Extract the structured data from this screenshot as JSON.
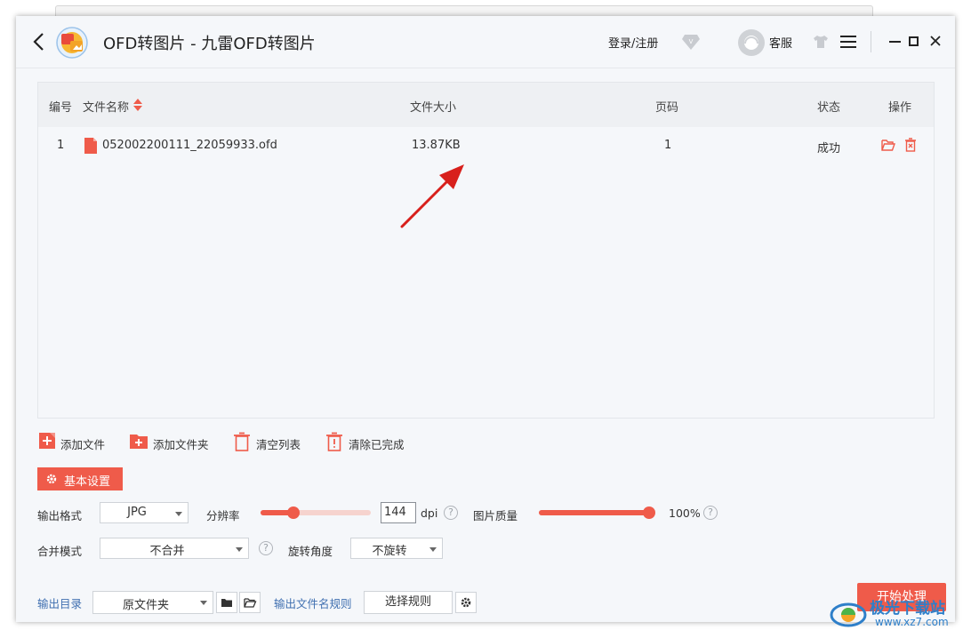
{
  "app": {
    "title": "OFD转图片 - 九雷OFD转图片",
    "login_label": "登录/注册",
    "service_label": "客服"
  },
  "table": {
    "columns": {
      "index": "编号",
      "filename": "文件名称",
      "size": "文件大小",
      "pages": "页码",
      "status": "状态",
      "actions": "操作"
    },
    "rows": [
      {
        "index": "1",
        "filename": "052002200111_22059933.ofd",
        "size": "13.87KB",
        "pages": "1",
        "status": "成功"
      }
    ]
  },
  "actions": {
    "add_file": "添加文件",
    "add_folder": "添加文件夹",
    "clear_list": "清空列表",
    "clear_done": "清除已完成"
  },
  "settings": {
    "tab_label": "基本设置",
    "format_label": "输出格式",
    "format_value": "JPG",
    "resolution_label": "分辨率",
    "resolution_value": "144",
    "resolution_unit": "dpi",
    "resolution_slider_fraction": 0.3,
    "quality_label": "图片质量",
    "quality_value": "100%",
    "quality_slider_fraction": 1.0,
    "merge_label": "合并模式",
    "merge_value": "不合并",
    "rotate_label": "旋转角度",
    "rotate_value": "不旋转",
    "help_glyph": "?"
  },
  "output": {
    "dir_label": "输出目录",
    "dir_value": "原文件夹",
    "rule_label": "输出文件名规则",
    "rule_button": "选择规则",
    "start_button": "开始处理"
  },
  "watermark": {
    "text": "极光下载站",
    "sub": "www.xz7.com"
  },
  "colors": {
    "accent": "#ef5b4a",
    "annotation_arrow": "#d8201c"
  }
}
